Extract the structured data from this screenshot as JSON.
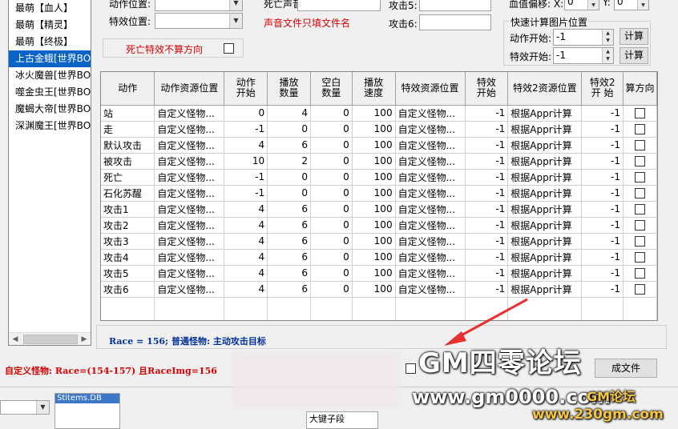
{
  "left_list": {
    "items": [
      "最萌【血人】",
      "最萌【精灵】",
      "最萌【终极】",
      "上古金蛾[世界BOSS",
      "冰火魔兽[世界BOSS",
      "噬金虫王[世界BOSS",
      "魔蝎大帝[世界BOSS",
      "深渊魔王[世界BOSS"
    ],
    "selected_index": 3
  },
  "form": {
    "action_pos_label": "动作位置:",
    "effect_pos_label": "特效位置:",
    "death_sound_label": "死亡声音:",
    "sound_hint": "声音文件只填文件名",
    "attack5_label": "攻击5:",
    "attack6_label": "攻击6:",
    "blood_offset_label": "血值偏移: X:",
    "blood_x": "0",
    "blood_y_label": "Y:",
    "blood_y": "0",
    "death_effect_label": "死亡特效不算方向"
  },
  "quick_calc": {
    "title": "快速计算图片位置",
    "action_start_label": "动作开始:",
    "action_start_value": "-1",
    "effect_start_label": "特效开始:",
    "effect_start_value": "-1",
    "calc_button": "计算",
    "calc_button2": "计算"
  },
  "grid": {
    "headers": [
      "动作",
      "动作资源位置",
      "动作\n开始",
      "播放\n数量",
      "空白\n数量",
      "播放\n速度",
      "特效资源位置",
      "特效\n开始",
      "特效2资源位置",
      "特效2\n开 始",
      "算方向"
    ],
    "rows": [
      [
        "站",
        "自定义怪物...",
        "0",
        "4",
        "0",
        "100",
        "自定义怪物...",
        "-1",
        "根据Appr计算",
        "-1"
      ],
      [
        "走",
        "自定义怪物...",
        "-1",
        "0",
        "0",
        "100",
        "自定义怪物...",
        "-1",
        "根据Appr计算",
        "-1"
      ],
      [
        "默认攻击",
        "自定义怪物...",
        "4",
        "6",
        "0",
        "100",
        "自定义怪物...",
        "-1",
        "根据Appr计算",
        "-1"
      ],
      [
        "被攻击",
        "自定义怪物...",
        "10",
        "2",
        "0",
        "100",
        "自定义怪物...",
        "-1",
        "根据Appr计算",
        "-1"
      ],
      [
        "死亡",
        "自定义怪物...",
        "-1",
        "0",
        "0",
        "100",
        "自定义怪物...",
        "-1",
        "根据Appr计算",
        "-1"
      ],
      [
        "石化苏醒",
        "自定义怪物...",
        "-1",
        "0",
        "0",
        "100",
        "自定义怪物...",
        "-1",
        "根据Appr计算",
        "-1"
      ],
      [
        "攻击1",
        "自定义怪物...",
        "4",
        "6",
        "0",
        "100",
        "自定义怪物...",
        "-1",
        "根据Appr计算",
        "-1"
      ],
      [
        "攻击2",
        "自定义怪物...",
        "4",
        "6",
        "0",
        "100",
        "自定义怪物...",
        "-1",
        "根据Appr计算",
        "-1"
      ],
      [
        "攻击3",
        "自定义怪物...",
        "4",
        "6",
        "0",
        "100",
        "自定义怪物...",
        "-1",
        "根据Appr计算",
        "-1"
      ],
      [
        "攻击4",
        "自定义怪物...",
        "4",
        "6",
        "0",
        "100",
        "自定义怪物...",
        "-1",
        "根据Appr计算",
        "-1"
      ],
      [
        "攻击5",
        "自定义怪物...",
        "4",
        "6",
        "0",
        "100",
        "自定义怪物...",
        "-1",
        "根据Appr计算",
        "-1"
      ],
      [
        "攻击6",
        "自定义怪物...",
        "4",
        "6",
        "0",
        "100",
        "自定义怪物...",
        "-1",
        "根据Appr计算",
        "-1"
      ]
    ]
  },
  "status": {
    "race_info": "Race = 156; 普通怪物: 主动攻击目标",
    "custom_info": "自定义怪物: Race=(154-157) 且RaceImg=156",
    "gen_button": "成文件",
    "bottom_panel_text": "Stitems.DB",
    "bottom_field_text": "大键子段"
  },
  "watermark": {
    "line1": "GM四零论坛",
    "line2": "www.gm0000.com",
    "line3": "GM论坛",
    "line4": "www.230gm.com"
  },
  "colors": {
    "selection": "#0a64c8",
    "red_text": "#d40000",
    "blue_text": "#00309c"
  }
}
